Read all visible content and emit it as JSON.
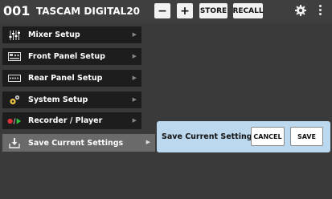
{
  "header": {
    "scene_number": "001",
    "scene_name": "TASCAM DIGITAL20",
    "minus_label": "−",
    "plus_label": "+",
    "store_label": "STORE",
    "recall_label": "RECALL",
    "settings_icon": "gear-icon",
    "more_icon": "more-vertical-icon"
  },
  "menu": {
    "items": [
      {
        "label": "Mixer Setup",
        "icon": "mixer-faders-icon"
      },
      {
        "label": "Front Panel Setup",
        "icon": "front-panel-icon"
      },
      {
        "label": "Rear Panel Setup",
        "icon": "rear-panel-icon"
      },
      {
        "label": "System Setup",
        "icon": "system-gear-icon"
      },
      {
        "label": "Recorder / Player",
        "icon": "record-play-icon"
      },
      {
        "label": "Save Current Settings",
        "icon": "save-download-icon"
      }
    ],
    "active_index": 5
  },
  "dialog": {
    "message": "Save Current Settings?",
    "cancel_label": "CANCEL",
    "save_label": "SAVE"
  },
  "colors": {
    "background": "#3a3a3a",
    "menu_item": "#1d1d1d",
    "menu_active": "#6a6a6a",
    "dialog": "#bcd8ee",
    "record_red": "#e0303a",
    "play_green": "#2fbf3a"
  }
}
